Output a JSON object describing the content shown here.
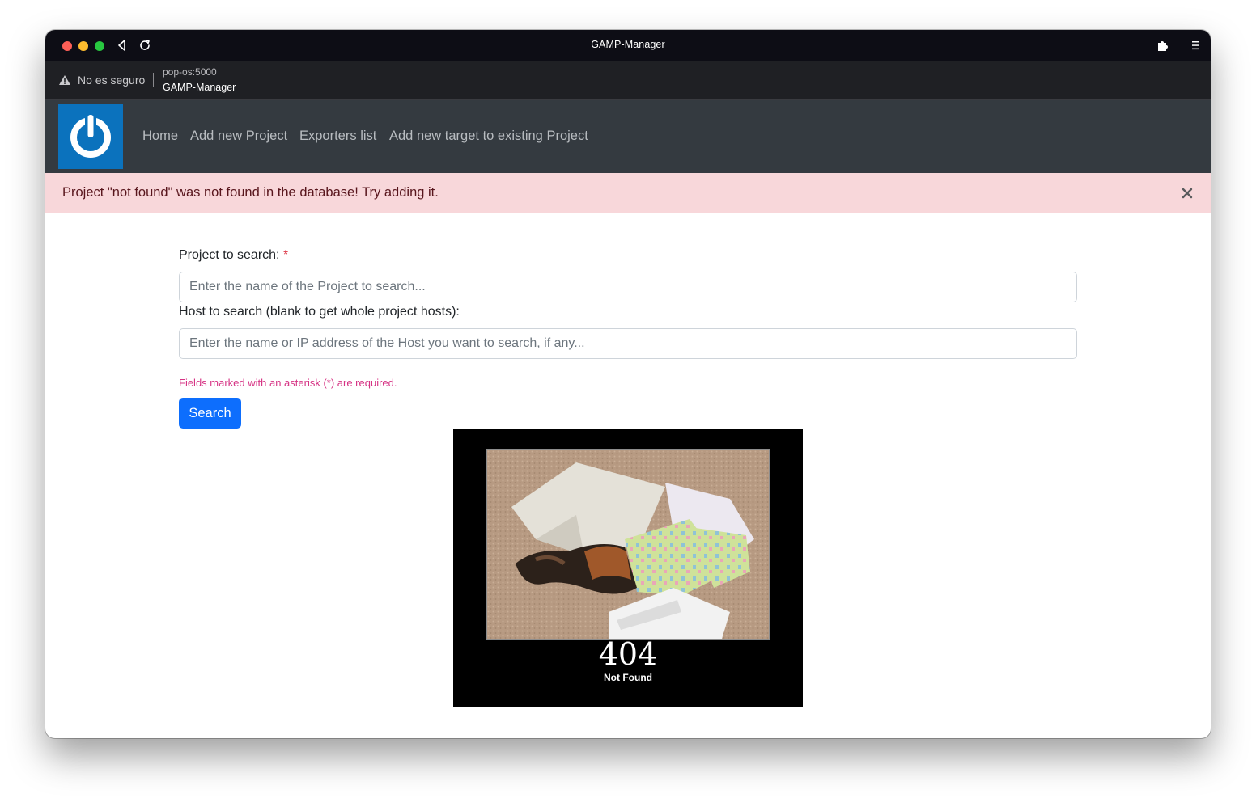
{
  "browser": {
    "window_title": "GAMP-Manager",
    "security_warning": "No es seguro",
    "address_host": "pop-os:5000",
    "address_title": "GAMP-Manager"
  },
  "navbar": {
    "links": [
      {
        "label": "Home"
      },
      {
        "label": "Add new Project"
      },
      {
        "label": "Exporters list"
      },
      {
        "label": "Add new target to existing Project"
      }
    ]
  },
  "alert": {
    "message": "Project \"not found\" was not found in the database! Try adding it."
  },
  "form": {
    "project_label": "Project to search:",
    "required_marker": "*",
    "project_placeholder": "Enter the name of the Project to search...",
    "project_value": "",
    "host_label": "Host to search (blank to get whole project hosts):",
    "host_placeholder": "Enter the name or IP address of the Host you want to search, if any...",
    "host_value": "",
    "required_note": "Fields marked with an asterisk (*) are required.",
    "search_label": "Search"
  },
  "not_found_image": {
    "big_text": "404",
    "small_text": "Not Found"
  },
  "colors": {
    "navbar_bg": "#343a40",
    "alert_bg": "#f8d7da",
    "primary_button": "#0d6efd",
    "logo_bg": "#0b72bd",
    "required_note": "#d63384"
  },
  "icons": {
    "back": "back-arrow-icon",
    "reload": "reload-icon",
    "extensions": "puzzle-icon",
    "menu": "hamburger-menu-icon",
    "warning": "warning-triangle-icon",
    "close": "close-icon",
    "logo": "power-logo-icon"
  }
}
